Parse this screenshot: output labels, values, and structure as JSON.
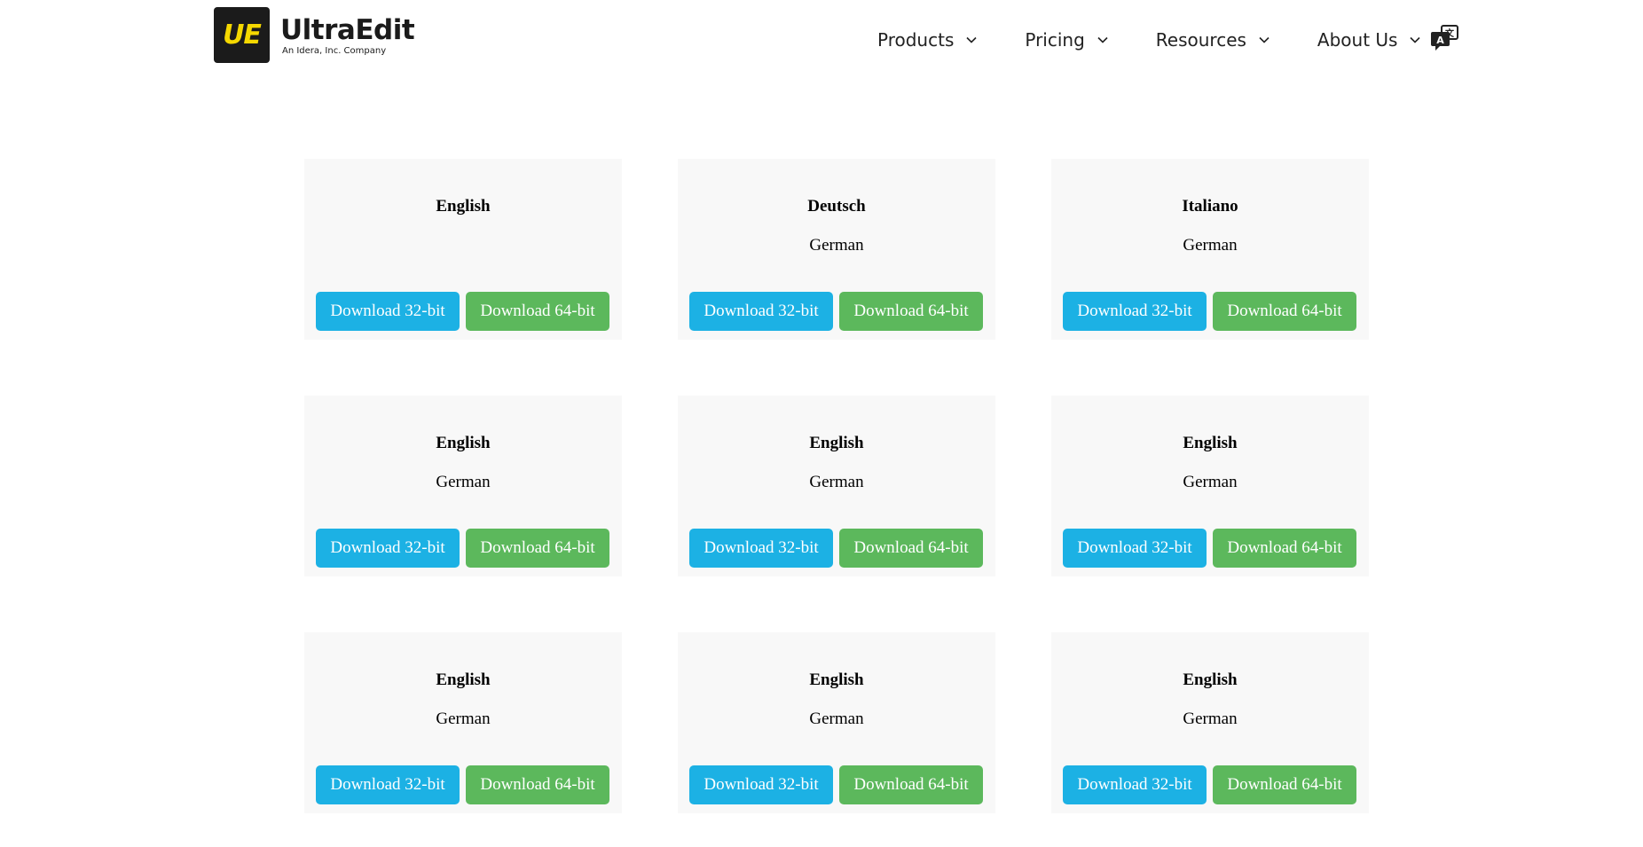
{
  "header": {
    "logo_mark": "UE",
    "logo_name": "UltraEdit",
    "logo_tagline": "An Idera, Inc. Company",
    "nav": [
      {
        "label": "Products"
      },
      {
        "label": "Pricing"
      },
      {
        "label": "Resources"
      },
      {
        "label": "About Us"
      }
    ],
    "language_icon": "translate-icon"
  },
  "colors": {
    "download_32": "#1cb1e4",
    "download_64": "#5cb85c",
    "card_bg": "#f8f8f8",
    "logo_yellow": "#f5d800"
  },
  "cards": [
    {
      "title": "English",
      "subtitle": "",
      "btn32": "Download 32-bit",
      "btn64": "Download 64-bit"
    },
    {
      "title": "Deutsch",
      "subtitle": "German",
      "btn32": "Download 32-bit",
      "btn64": "Download 64-bit"
    },
    {
      "title": "Italiano",
      "subtitle": "German",
      "btn32": "Download 32-bit",
      "btn64": "Download 64-bit"
    },
    {
      "title": "English",
      "subtitle": "German",
      "btn32": "Download 32-bit",
      "btn64": "Download 64-bit"
    },
    {
      "title": "English",
      "subtitle": "German",
      "btn32": "Download 32-bit",
      "btn64": "Download 64-bit"
    },
    {
      "title": "English",
      "subtitle": "German",
      "btn32": "Download 32-bit",
      "btn64": "Download 64-bit"
    },
    {
      "title": "English",
      "subtitle": "German",
      "btn32": "Download 32-bit",
      "btn64": "Download 64-bit"
    },
    {
      "title": "English",
      "subtitle": "German",
      "btn32": "Download 32-bit",
      "btn64": "Download 64-bit"
    },
    {
      "title": "English",
      "subtitle": "German",
      "btn32": "Download 32-bit",
      "btn64": "Download 64-bit"
    }
  ]
}
